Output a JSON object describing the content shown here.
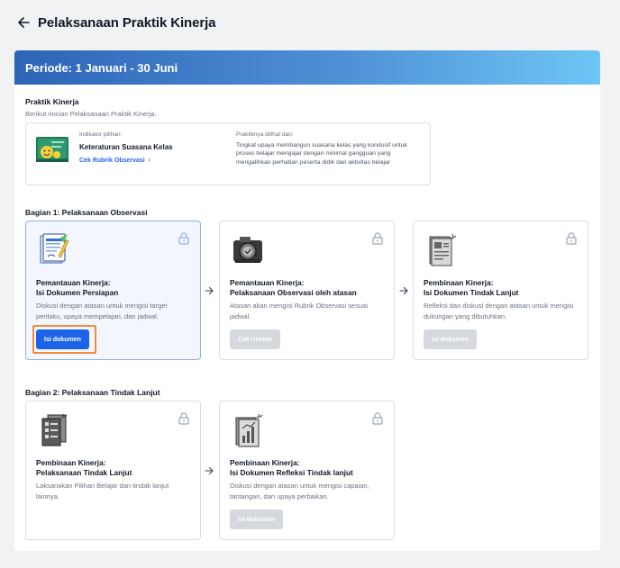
{
  "header": {
    "title": "Pelaksanaan Praktik Kinerja"
  },
  "banner": {
    "title": "Periode: 1 Januari - 30 Juni"
  },
  "praktik": {
    "title": "Praktik Kinerja",
    "subtitle": "Berikut rincian Pelaksanaan Praktik Kinerja.",
    "indicator_label": "Indikator pilihan:",
    "indicator_name": "Keteraturan Suasana Kelas",
    "indicator_link": "Cek Rubrik Observasi",
    "seen_label": "Praktiknya dilihat dari:",
    "seen_text": "Tingkat upaya membangun suasana kelas yang kondusif untuk proses belajar mengajar dengan minimal gangguan yang mengalihkan perhatian peserta didik dari aktivitas belajar"
  },
  "bagian1": {
    "title": "Bagian 1: Pelaksanaan Observasi",
    "steps": [
      {
        "title_1": "Pemantauan Kinerja:",
        "title_2": "Isi Dokumen Persiapan",
        "desc": "Diskusi dengan atasan untuk mengisi target perilaku, upaya mempelajari, dan jadwal.",
        "button": "Isi dokumen"
      },
      {
        "title_1": "Pemantauan Kinerja:",
        "title_2": "Pelaksanaan Observasi oleh atasan",
        "desc": "Atasan akan mengisi Rubrik Observasi sesuai jadwal.",
        "button": "Cek rincian"
      },
      {
        "title_1": "Pembinaan Kinerja:",
        "title_2": "Isi Dokumen Tindak Lanjut",
        "desc": "Refleksi dan diskusi dengan atasan untuk mengisi dukungan yang dibutuhkan.",
        "button": "Isi dokumen"
      }
    ]
  },
  "bagian2": {
    "title": "Bagian 2: Pelaksanaan Tindak Lanjut",
    "steps": [
      {
        "title_1": "Pembinaan Kinerja:",
        "title_2": "Pelaksanaan Tindak Lanjut",
        "desc": "Laksanakan Pilihan Belajar dan tindak lanjut lainnya."
      },
      {
        "title_1": "Pembinaan Kinerja:",
        "title_2": "Isi Dokumen Refleksi Tindak lanjut",
        "desc": "Diskusi dengan atasan untuk mengisi capaian, tantangan, dan upaya perbaikan.",
        "button": "Isi dokumen"
      }
    ]
  },
  "colors": {
    "primary": "#1d63e8",
    "highlight": "#f08a3c",
    "banner_start": "#2e64b6",
    "banner_end": "#6ec6f5"
  }
}
